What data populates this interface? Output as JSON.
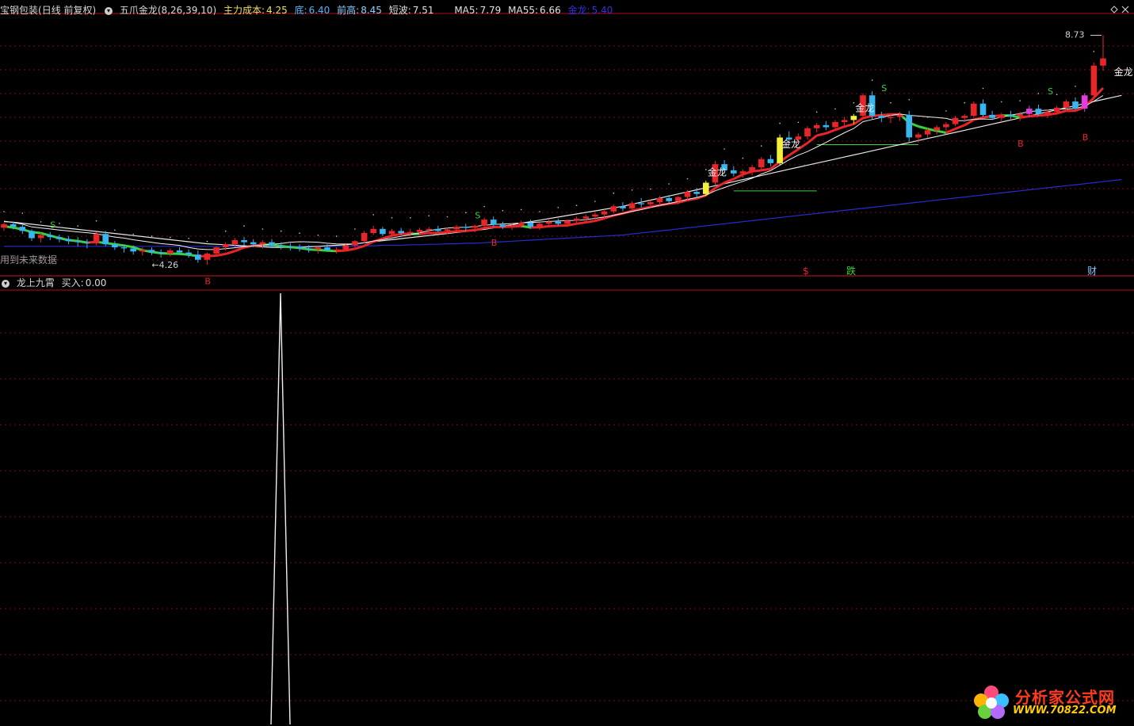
{
  "top": {
    "stock": "宝钢包装",
    "period": "(日线 前复权)",
    "indicator": "五爪金龙",
    "params": "(8,26,39,10)",
    "main_cost_label": "主力成本:",
    "main_cost": "4.25",
    "bottom_label": "底:",
    "bottom": "6.40",
    "prev_high_label": "前高:",
    "prev_high": "8.45",
    "short_wave_label": "短波:",
    "short_wave": "7.51",
    "ma5_label": "MA5:",
    "ma5": "7.79",
    "ma55_label": "MA55:",
    "ma55": "6.66",
    "golden_label": "金龙:",
    "golden": "5.40",
    "future_note": "用到未来数据"
  },
  "bottom_panel": {
    "indicator": "龙上九霄",
    "buy_label": "买入:",
    "buy": "0.00"
  },
  "annotations": {
    "max_price": "8.73",
    "min_price": "4.26",
    "golden_tag": "金龙",
    "sell_tag": "S",
    "buy_tag": "B",
    "fall_tag": "跌",
    "money_tag": "财",
    "dollar_tag": "$"
  },
  "logo": {
    "brand": "分析家公式网",
    "url": "WWW.70822.COM"
  },
  "colors": {
    "up": "#e8262a",
    "down": "#37b6f0",
    "grid": "#7a0d12",
    "ma_white": "#e8e8e8",
    "ma_blue": "#2a2ad0",
    "green": "#39d23c",
    "yellow": "#f5f03a",
    "magenta": "#e23ce0"
  },
  "chart_data": {
    "type": "candlestick",
    "candles": [
      [
        4.98,
        5.08,
        4.92,
        5.05
      ],
      [
        5.05,
        5.1,
        4.95,
        5.0
      ],
      [
        5.0,
        5.05,
        4.86,
        4.92
      ],
      [
        4.92,
        4.95,
        4.72,
        4.78
      ],
      [
        4.78,
        4.88,
        4.7,
        4.84
      ],
      [
        4.84,
        4.9,
        4.74,
        4.8
      ],
      [
        4.8,
        4.85,
        4.7,
        4.76
      ],
      [
        4.76,
        4.82,
        4.66,
        4.72
      ],
      [
        4.72,
        4.8,
        4.62,
        4.7
      ],
      [
        4.7,
        4.76,
        4.58,
        4.68
      ],
      [
        4.68,
        4.9,
        4.64,
        4.86
      ],
      [
        4.86,
        4.92,
        4.62,
        4.66
      ],
      [
        4.66,
        4.72,
        4.55,
        4.6
      ],
      [
        4.6,
        4.66,
        4.5,
        4.58
      ],
      [
        4.58,
        4.64,
        4.46,
        4.52
      ],
      [
        4.52,
        4.6,
        4.44,
        4.55
      ],
      [
        4.55,
        4.6,
        4.45,
        4.5
      ],
      [
        4.5,
        4.56,
        4.4,
        4.48
      ],
      [
        4.48,
        4.58,
        4.42,
        4.54
      ],
      [
        4.54,
        4.6,
        4.45,
        4.5
      ],
      [
        4.5,
        4.56,
        4.4,
        4.46
      ],
      [
        4.46,
        4.54,
        4.3,
        4.36
      ],
      [
        4.36,
        4.5,
        4.26,
        4.48
      ],
      [
        4.48,
        4.62,
        4.44,
        4.6
      ],
      [
        4.6,
        4.7,
        4.54,
        4.66
      ],
      [
        4.66,
        4.78,
        4.6,
        4.74
      ],
      [
        4.74,
        4.8,
        4.64,
        4.7
      ],
      [
        4.7,
        4.76,
        4.6,
        4.66
      ],
      [
        4.66,
        4.74,
        4.58,
        4.7
      ],
      [
        4.7,
        4.76,
        4.6,
        4.64
      ],
      [
        4.64,
        4.7,
        4.56,
        4.62
      ],
      [
        4.62,
        4.68,
        4.54,
        4.6
      ],
      [
        4.6,
        4.66,
        4.52,
        4.58
      ],
      [
        4.58,
        4.64,
        4.5,
        4.56
      ],
      [
        4.56,
        4.62,
        4.48,
        4.6
      ],
      [
        4.6,
        4.66,
        4.52,
        4.54
      ],
      [
        4.54,
        4.6,
        4.48,
        4.56
      ],
      [
        4.56,
        4.66,
        4.52,
        4.64
      ],
      [
        4.64,
        4.74,
        4.6,
        4.72
      ],
      [
        4.72,
        4.92,
        4.68,
        4.88
      ],
      [
        4.88,
        5.02,
        4.84,
        4.96
      ],
      [
        4.96,
        5.0,
        4.82,
        4.86
      ],
      [
        4.86,
        4.96,
        4.8,
        4.92
      ],
      [
        4.92,
        4.98,
        4.84,
        4.88
      ],
      [
        4.88,
        4.96,
        4.82,
        4.9
      ],
      [
        4.9,
        4.98,
        4.84,
        4.94
      ],
      [
        4.94,
        5.0,
        4.88,
        4.96
      ],
      [
        4.96,
        5.02,
        4.9,
        4.92
      ],
      [
        4.92,
        4.98,
        4.86,
        4.95
      ],
      [
        4.95,
        5.04,
        4.9,
        5.0
      ],
      [
        5.0,
        5.06,
        4.92,
        4.98
      ],
      [
        4.98,
        5.04,
        4.9,
        5.02
      ],
      [
        5.02,
        5.18,
        4.98,
        5.14
      ],
      [
        5.14,
        5.2,
        5.0,
        5.04
      ],
      [
        5.04,
        5.1,
        4.96,
        5.0
      ],
      [
        5.0,
        5.08,
        4.94,
        5.02
      ],
      [
        5.02,
        5.12,
        4.98,
        5.08
      ],
      [
        5.08,
        5.14,
        4.96,
        5.0
      ],
      [
        5.0,
        5.08,
        4.94,
        5.06
      ],
      [
        5.06,
        5.14,
        5.0,
        5.1
      ],
      [
        5.1,
        5.16,
        5.02,
        5.06
      ],
      [
        5.06,
        5.14,
        5.0,
        5.12
      ],
      [
        5.12,
        5.2,
        5.06,
        5.16
      ],
      [
        5.16,
        5.24,
        5.1,
        5.2
      ],
      [
        5.2,
        5.28,
        5.12,
        5.24
      ],
      [
        5.24,
        5.34,
        5.18,
        5.3
      ],
      [
        5.3,
        5.44,
        5.26,
        5.4
      ],
      [
        5.4,
        5.48,
        5.3,
        5.36
      ],
      [
        5.36,
        5.5,
        5.32,
        5.46
      ],
      [
        5.46,
        5.56,
        5.38,
        5.44
      ],
      [
        5.44,
        5.52,
        5.36,
        5.48
      ],
      [
        5.48,
        5.6,
        5.42,
        5.56
      ],
      [
        5.56,
        5.62,
        5.46,
        5.5
      ],
      [
        5.5,
        5.6,
        5.44,
        5.58
      ],
      [
        5.58,
        5.72,
        5.52,
        5.68
      ],
      [
        5.68,
        5.76,
        5.56,
        5.64
      ],
      [
        5.64,
        5.9,
        5.6,
        5.86
      ],
      [
        5.86,
        6.28,
        5.8,
        6.22
      ],
      [
        6.22,
        6.3,
        6.04,
        6.1
      ],
      [
        6.1,
        6.18,
        5.98,
        6.04
      ],
      [
        6.04,
        6.12,
        5.96,
        6.08
      ],
      [
        6.08,
        6.2,
        6.0,
        6.16
      ],
      [
        6.16,
        6.36,
        6.1,
        6.32
      ],
      [
        6.32,
        6.4,
        6.18,
        6.24
      ],
      [
        6.24,
        6.8,
        6.2,
        6.74
      ],
      [
        6.74,
        6.86,
        6.6,
        6.7
      ],
      [
        6.7,
        6.82,
        6.62,
        6.76
      ],
      [
        6.76,
        6.96,
        6.7,
        6.92
      ],
      [
        6.92,
        7.02,
        6.84,
        6.98
      ],
      [
        6.98,
        7.06,
        6.88,
        6.94
      ],
      [
        6.94,
        7.08,
        6.88,
        7.04
      ],
      [
        7.04,
        7.14,
        6.96,
        7.08
      ],
      [
        7.08,
        7.2,
        7.0,
        7.16
      ],
      [
        7.16,
        7.6,
        7.1,
        7.56
      ],
      [
        7.56,
        7.64,
        7.1,
        7.16
      ],
      [
        7.16,
        7.24,
        7.04,
        7.12
      ],
      [
        7.12,
        7.2,
        7.02,
        7.14
      ],
      [
        7.14,
        7.24,
        7.06,
        7.18
      ],
      [
        7.18,
        7.26,
        6.66,
        6.74
      ],
      [
        6.74,
        6.84,
        6.64,
        6.8
      ],
      [
        6.8,
        6.92,
        6.74,
        6.88
      ],
      [
        6.88,
        6.98,
        6.8,
        6.94
      ],
      [
        6.94,
        7.04,
        6.86,
        7.0
      ],
      [
        7.0,
        7.16,
        6.96,
        7.12
      ],
      [
        7.12,
        7.2,
        7.04,
        7.16
      ],
      [
        7.16,
        7.44,
        7.12,
        7.4
      ],
      [
        7.4,
        7.48,
        7.14,
        7.18
      ],
      [
        7.18,
        7.26,
        7.08,
        7.12
      ],
      [
        7.12,
        7.22,
        7.04,
        7.18
      ],
      [
        7.18,
        7.26,
        7.1,
        7.16
      ],
      [
        7.16,
        7.24,
        7.06,
        7.2
      ],
      [
        7.2,
        7.36,
        7.14,
        7.3
      ],
      [
        7.3,
        7.38,
        7.16,
        7.2
      ],
      [
        7.2,
        7.28,
        7.12,
        7.24
      ],
      [
        7.24,
        7.36,
        7.18,
        7.32
      ],
      [
        7.32,
        7.48,
        7.26,
        7.44
      ],
      [
        7.44,
        7.52,
        7.28,
        7.3
      ],
      [
        7.3,
        7.6,
        7.24,
        7.56
      ],
      [
        7.56,
        8.2,
        7.5,
        8.14
      ],
      [
        8.14,
        8.73,
        8.04,
        8.28
      ]
    ],
    "ma_white": [
      5.1,
      5.09,
      5.07,
      5.05,
      5.03,
      5.01,
      4.99,
      4.97,
      4.95,
      4.93,
      4.91,
      4.89,
      4.87,
      4.85,
      4.83,
      4.81,
      4.79,
      4.77,
      4.75,
      4.73,
      4.71,
      4.69,
      4.67,
      4.66,
      4.65,
      4.64,
      4.63,
      4.62,
      4.61,
      4.6,
      4.6,
      4.6,
      4.6,
      4.61,
      4.62,
      4.63,
      4.64,
      4.65,
      4.67,
      4.69,
      4.71,
      4.73,
      4.75,
      4.77,
      4.79,
      4.81,
      4.83,
      4.85,
      4.87,
      4.89,
      4.91,
      4.93,
      4.95,
      4.98,
      5.01,
      5.04,
      5.07,
      5.1,
      5.13,
      5.16,
      5.19,
      5.22,
      5.25,
      5.28,
      5.31,
      5.34,
      5.37,
      5.4,
      5.44,
      5.48,
      5.52,
      5.56,
      5.6,
      5.64,
      5.68,
      5.72,
      5.76,
      5.8,
      5.84,
      5.88,
      5.92,
      5.96,
      6.0,
      6.04,
      6.08,
      6.12,
      6.16,
      6.2,
      6.24,
      6.28,
      6.32,
      6.36,
      6.4,
      6.44,
      6.48,
      6.52,
      6.56,
      6.6,
      6.64,
      6.68,
      6.72,
      6.76,
      6.8,
      6.84,
      6.88,
      6.92,
      6.96,
      7.0,
      7.04,
      7.08,
      7.12,
      7.16,
      7.2,
      7.24,
      7.28,
      7.32,
      7.36,
      7.4,
      7.44,
      7.48,
      7.52,
      7.56
    ],
    "ma_blue": [
      4.62,
      4.62,
      4.62,
      4.62,
      4.62,
      4.62,
      4.62,
      4.62,
      4.62,
      4.62,
      4.62,
      4.62,
      4.62,
      4.62,
      4.62,
      4.62,
      4.62,
      4.62,
      4.62,
      4.62,
      4.62,
      4.62,
      4.62,
      4.62,
      4.62,
      4.62,
      4.62,
      4.62,
      4.62,
      4.62,
      4.62,
      4.62,
      4.62,
      4.62,
      4.62,
      4.62,
      4.62,
      4.62,
      4.63,
      4.63,
      4.63,
      4.64,
      4.64,
      4.64,
      4.65,
      4.65,
      4.66,
      4.66,
      4.67,
      4.67,
      4.68,
      4.68,
      4.69,
      4.7,
      4.71,
      4.72,
      4.73,
      4.74,
      4.75,
      4.76,
      4.77,
      4.78,
      4.79,
      4.8,
      4.81,
      4.82,
      4.83,
      4.84,
      4.86,
      4.88,
      4.9,
      4.92,
      4.94,
      4.96,
      4.98,
      5.0,
      5.02,
      5.04,
      5.06,
      5.08,
      5.1,
      5.12,
      5.14,
      5.16,
      5.18,
      5.2,
      5.22,
      5.24,
      5.26,
      5.28,
      5.3,
      5.32,
      5.34,
      5.36,
      5.38,
      5.4,
      5.42,
      5.44,
      5.46,
      5.48,
      5.5,
      5.52,
      5.54,
      5.56,
      5.58,
      5.6,
      5.62,
      5.64,
      5.66,
      5.68,
      5.7,
      5.72,
      5.74,
      5.76,
      5.78,
      5.8,
      5.82,
      5.84,
      5.86,
      5.88,
      5.9,
      5.92
    ],
    "signal": {
      "peak_index": 28,
      "peak_value": 1,
      "baseline": 0
    }
  }
}
